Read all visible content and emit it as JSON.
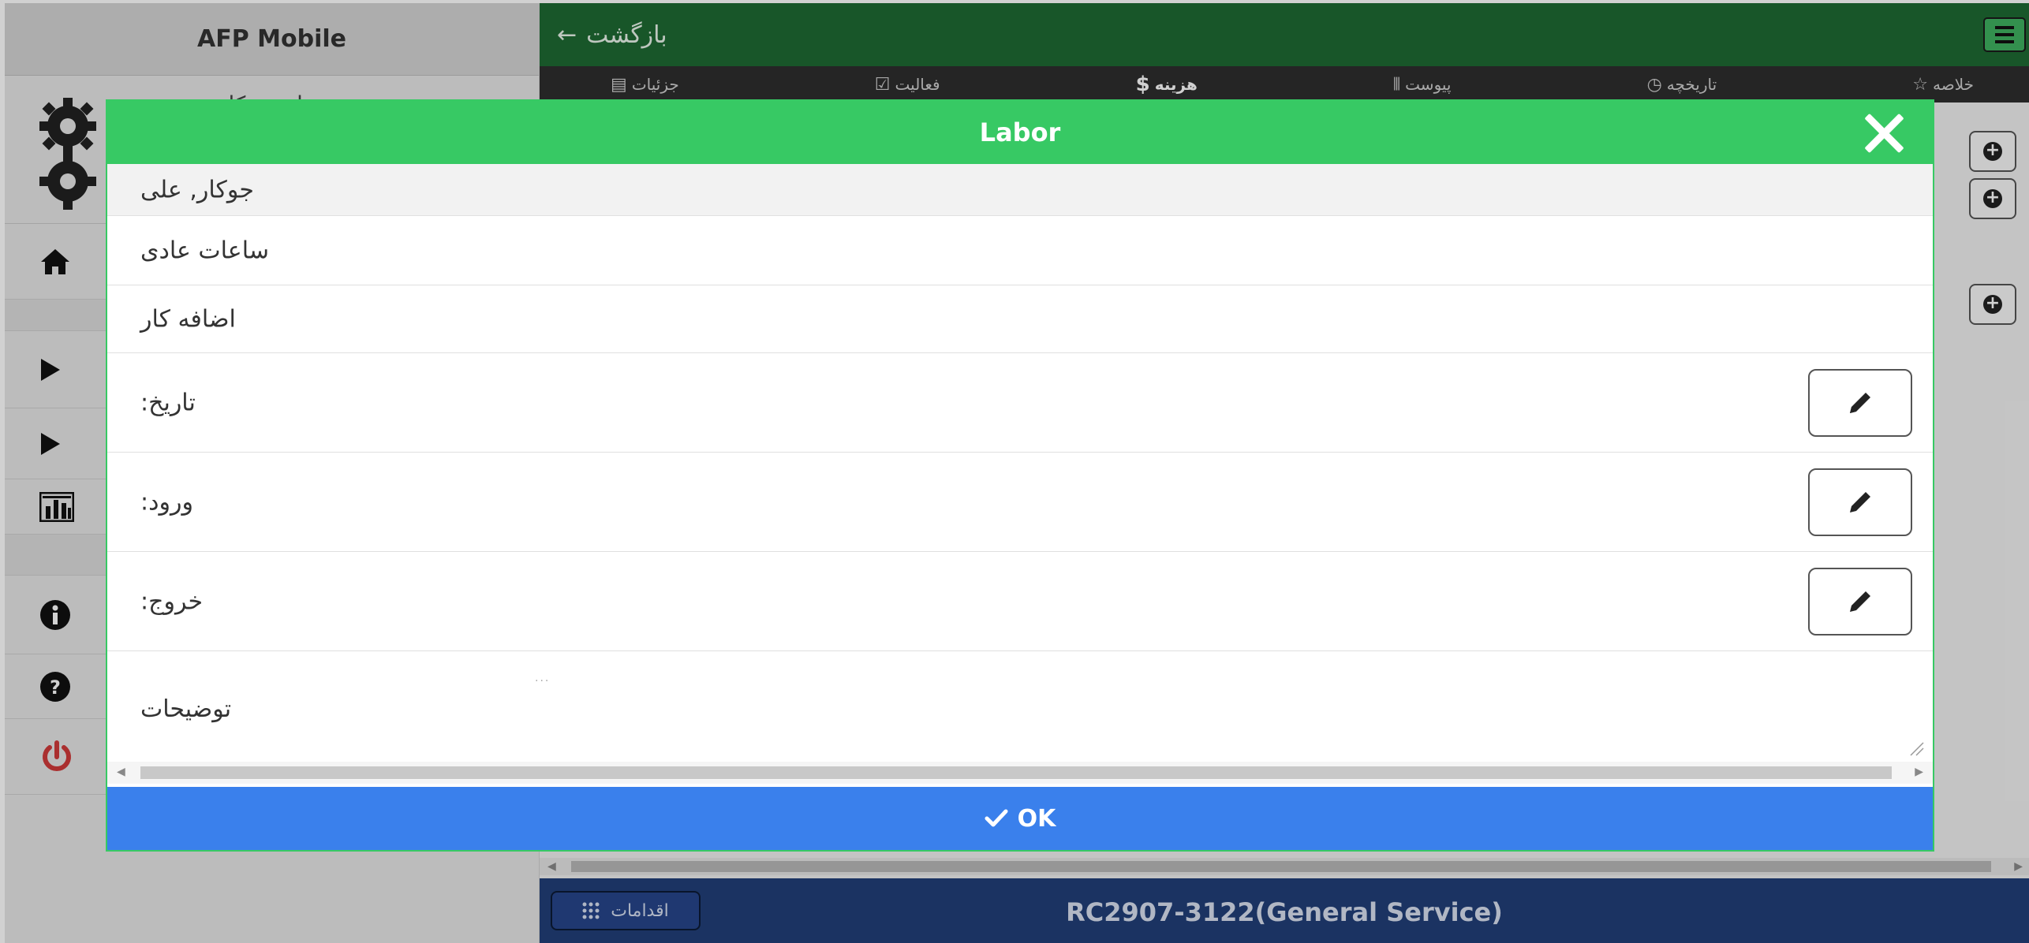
{
  "sidebar": {
    "app_title": "AFP Mobile",
    "user_name": "علی جوکار"
  },
  "main": {
    "back_label": "بازگشت",
    "tabs": [
      {
        "label": "خلاصه",
        "icon": "star-icon"
      },
      {
        "label": "تاریخچه",
        "icon": "history-icon"
      },
      {
        "label": "پیوست",
        "icon": "attachment-icon"
      },
      {
        "label": "هزینه",
        "icon": "dollar-icon"
      },
      {
        "label": "فعالیت",
        "icon": "checkbox-icon"
      },
      {
        "label": "جزئیات",
        "icon": "clipboard-icon"
      }
    ],
    "footer": {
      "actions_label": "اقدامات",
      "title": "RC2907-3122(General Service)"
    }
  },
  "modal": {
    "title": "Labor",
    "employee": "جوکار, علی",
    "regular_hours": "ساعات عادی",
    "overtime": "اضافه کار",
    "date_label": ":تاریخ",
    "entry_label": ":ورود",
    "exit_label": ":خروج",
    "description_label": "توضیحات",
    "description_dots": "...",
    "ok_label": "OK"
  },
  "colors": {
    "topbar": "#1e6a33",
    "modal_header": "#37c964",
    "ok_button": "#3a80ec",
    "footer": "#213f78",
    "power_icon": "#d03a3a"
  }
}
